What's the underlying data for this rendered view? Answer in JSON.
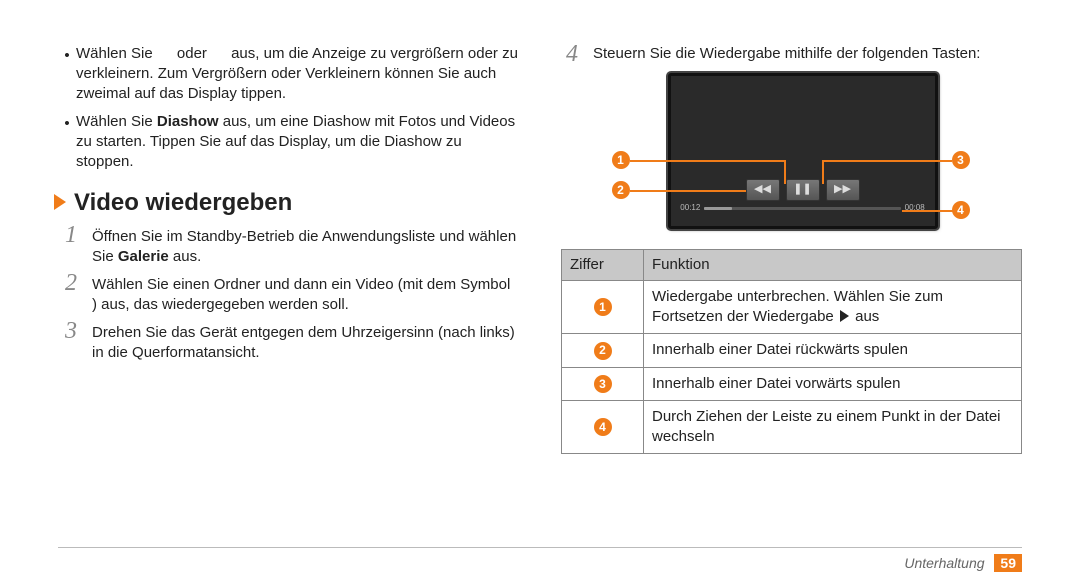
{
  "leftBullets": [
    {
      "pre": "Wählen Sie",
      "mid": "oder",
      "post": "aus, um die Anzeige zu vergrößern oder zu verkleinern. Zum Vergrößern oder Verkleinern können Sie auch zweimal auf das Display tippen."
    },
    {
      "pre": "Wählen Sie ",
      "bold": "Diashow",
      "post": " aus, um eine Diashow mit Fotos und Videos zu starten. Tippen Sie auf das Display, um die Diashow zu stoppen."
    }
  ],
  "sectionTitle": "Video wiedergeben",
  "steps": [
    {
      "n": "1",
      "pre": "Öffnen Sie im Standby-Betrieb die Anwendungsliste und wählen Sie ",
      "bold": "Galerie",
      "post": " aus."
    },
    {
      "n": "2",
      "text": "Wählen Sie einen Ordner und dann ein Video (mit dem Symbol         ) aus, das wiedergegeben werden soll."
    },
    {
      "n": "3",
      "text": "Drehen Sie das Gerät entgegen dem Uhrzeigersinn (nach links) in die Querformatansicht."
    }
  ],
  "rightStep": {
    "n": "4",
    "text": "Steuern Sie die Wiedergabe mithilfe der folgenden Tasten:"
  },
  "progress": {
    "left": "00:12",
    "right": "00:08"
  },
  "tableHead": {
    "c1": "Ziffer",
    "c2": "Funktion"
  },
  "rows": [
    {
      "z": "1",
      "f_pre": "Wiedergabe unterbrechen. Wählen Sie zum Fortsetzen der Wiedergabe ",
      "f_post": " aus"
    },
    {
      "z": "2",
      "f": "Innerhalb einer Datei rückwärts spulen"
    },
    {
      "z": "3",
      "f": "Innerhalb einer Datei vorwärts spulen"
    },
    {
      "z": "4",
      "f": "Durch Ziehen der Leiste zu einem Punkt in der Datei wechseln"
    }
  ],
  "footer": {
    "label": "Unterhaltung",
    "page": "59"
  },
  "icons": {
    "rewind": "◀◀",
    "pause": "❚❚",
    "forward": "▶▶"
  }
}
